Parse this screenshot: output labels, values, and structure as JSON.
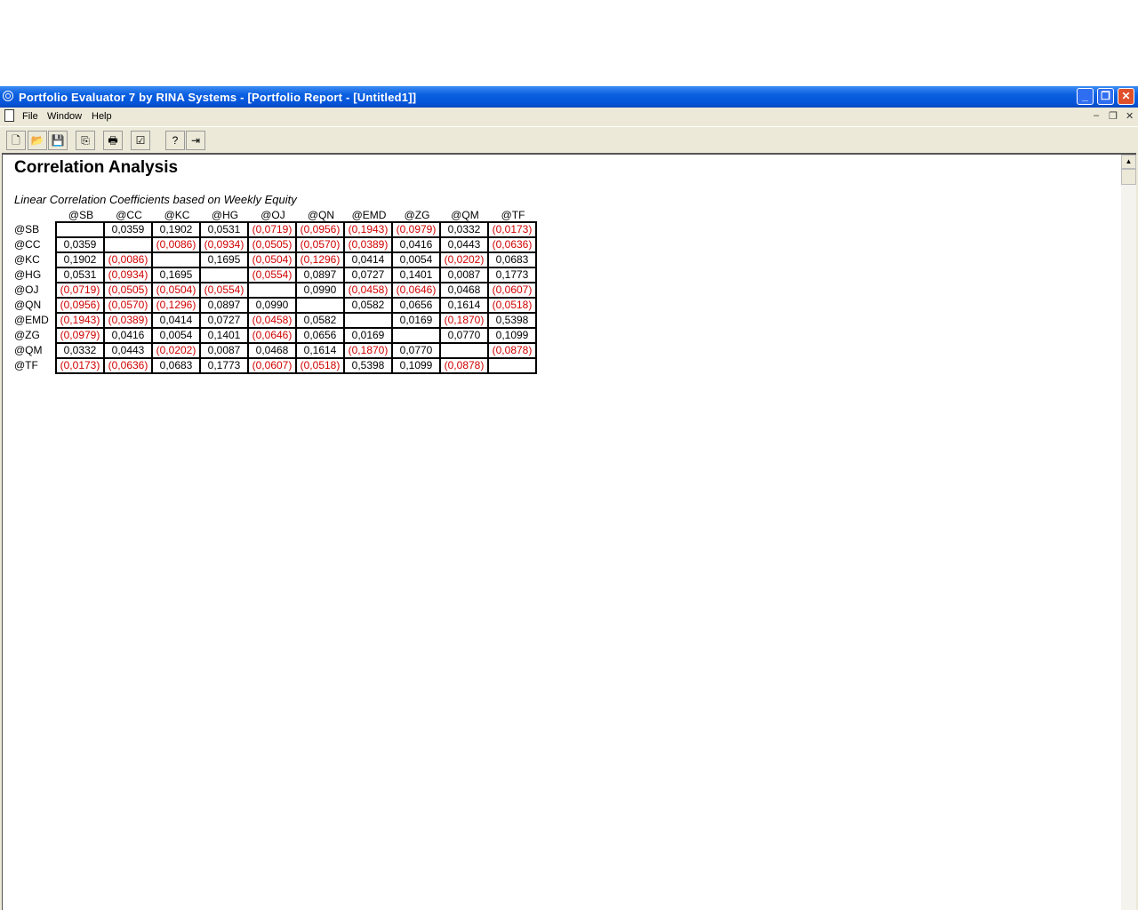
{
  "window": {
    "title": "Portfolio Evaluator 7 by RINA Systems - [Portfolio Report - [Untitled1]]"
  },
  "menu": [
    "File",
    "Window",
    "Help"
  ],
  "toolbar": [
    {
      "icon": "new-icon",
      "glyph": "🗋"
    },
    {
      "icon": "open-icon",
      "glyph": "📂"
    },
    {
      "icon": "save-icon",
      "glyph": "💾"
    },
    {
      "icon": "copy-icon",
      "glyph": "⎘"
    },
    {
      "icon": "print-icon",
      "glyph": "🖶"
    },
    {
      "icon": "properties-icon",
      "glyph": "☑"
    },
    {
      "icon": "help-icon",
      "glyph": "?"
    },
    {
      "icon": "exit-icon",
      "glyph": "⇥"
    }
  ],
  "report": {
    "title": "Correlation Analysis",
    "subtitle": "Linear Correlation Coefficients based on Weekly Equity",
    "symbols": [
      "@SB",
      "@CC",
      "@KC",
      "@HG",
      "@OJ",
      "@QN",
      "@EMD",
      "@ZG",
      "@QM",
      "@TF"
    ],
    "matrix": [
      [
        null,
        "0,0359",
        "0,1902",
        "0,0531",
        "(0,0719)",
        "(0,0956)",
        "(0,1943)",
        "(0,0979)",
        "0,0332",
        "(0,0173)"
      ],
      [
        "0,0359",
        null,
        "(0,0086)",
        "(0,0934)",
        "(0,0505)",
        "(0,0570)",
        "(0,0389)",
        "0,0416",
        "0,0443",
        "(0,0636)"
      ],
      [
        "0,1902",
        "(0,0086)",
        null,
        "0,1695",
        "(0,0504)",
        "(0,1296)",
        "0,0414",
        "0,0054",
        "(0,0202)",
        "0,0683"
      ],
      [
        "0,0531",
        "(0,0934)",
        "0,1695",
        null,
        "(0,0554)",
        "0,0897",
        "0,0727",
        "0,1401",
        "0,0087",
        "0,1773"
      ],
      [
        "(0,0719)",
        "(0,0505)",
        "(0,0504)",
        "(0,0554)",
        null,
        "0,0990",
        "(0,0458)",
        "(0,0646)",
        "0,0468",
        "(0,0607)"
      ],
      [
        "(0,0956)",
        "(0,0570)",
        "(0,1296)",
        "0,0897",
        "0,0990",
        null,
        "0,0582",
        "0,0656",
        "0,1614",
        "(0,0518)"
      ],
      [
        "(0,1943)",
        "(0,0389)",
        "0,0414",
        "0,0727",
        "(0,0458)",
        "0,0582",
        null,
        "0,0169",
        "(0,1870)",
        "0,5398"
      ],
      [
        "(0,0979)",
        "0,0416",
        "0,0054",
        "0,1401",
        "(0,0646)",
        "0,0656",
        "0,0169",
        null,
        "0,0770",
        "0,1099"
      ],
      [
        "0,0332",
        "0,0443",
        "(0,0202)",
        "0,0087",
        "0,0468",
        "0,1614",
        "(0,1870)",
        "0,0770",
        null,
        "(0,0878)"
      ],
      [
        "(0,0173)",
        "(0,0636)",
        "0,0683",
        "0,1773",
        "(0,0607)",
        "(0,0518)",
        "0,5398",
        "0,1099",
        "(0,0878)",
        null
      ]
    ]
  },
  "colors": {
    "negative": "#d00000",
    "titlebar": "#0a5fe0"
  }
}
